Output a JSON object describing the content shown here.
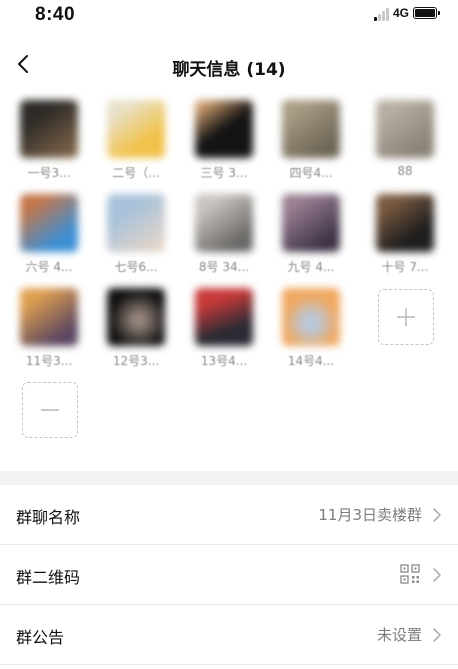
{
  "status_bar": {
    "time": "8:40",
    "network": "4G"
  },
  "header": {
    "title": "聊天信息 (14)"
  },
  "members": [
    {
      "name": "一号3...",
      "avatar_colors": [
        "#2e2b27",
        "#8a6d4f"
      ]
    },
    {
      "name": "二号（...",
      "avatar_colors": [
        "#f1c24a",
        "#e8e0c8"
      ]
    },
    {
      "name": "三号 3...",
      "avatar_colors": [
        "#141414",
        "#d0a070"
      ]
    },
    {
      "name": "四号4...",
      "avatar_colors": [
        "#6e6656",
        "#a89c84"
      ]
    },
    {
      "name": "88",
      "avatar_colors": [
        "#8c8378",
        "#b8afa3"
      ]
    },
    {
      "name": "六号 4...",
      "avatar_colors": [
        "#3d8fd4",
        "#c4764a"
      ]
    },
    {
      "name": "七号6...",
      "avatar_colors": [
        "#a7c2da",
        "#e2d4c8"
      ]
    },
    {
      "name": "8号 34...",
      "avatar_colors": [
        "#6a6866",
        "#c9c5c1"
      ]
    },
    {
      "name": "九号 4...",
      "avatar_colors": [
        "#3e3346",
        "#9a7f93"
      ]
    },
    {
      "name": "十号 7...",
      "avatar_colors": [
        "#1e1e1e",
        "#7a5a40"
      ]
    },
    {
      "name": "11号3...",
      "avatar_colors": [
        "#5a4560",
        "#e0a050"
      ]
    },
    {
      "name": "12号3...",
      "avatar_colors": [
        "#0e0e0e",
        "#9b8a82"
      ]
    },
    {
      "name": "13号4...",
      "avatar_colors": [
        "#2a2a33",
        "#c83a3a"
      ]
    },
    {
      "name": "14号4...",
      "avatar_colors": [
        "#f0a860",
        "#b8c8dc"
      ]
    }
  ],
  "settings": [
    {
      "label": "群聊名称",
      "value": "11月3日卖楼群"
    },
    {
      "label": "群二维码",
      "value": ""
    },
    {
      "label": "群公告",
      "value": "未设置"
    }
  ]
}
